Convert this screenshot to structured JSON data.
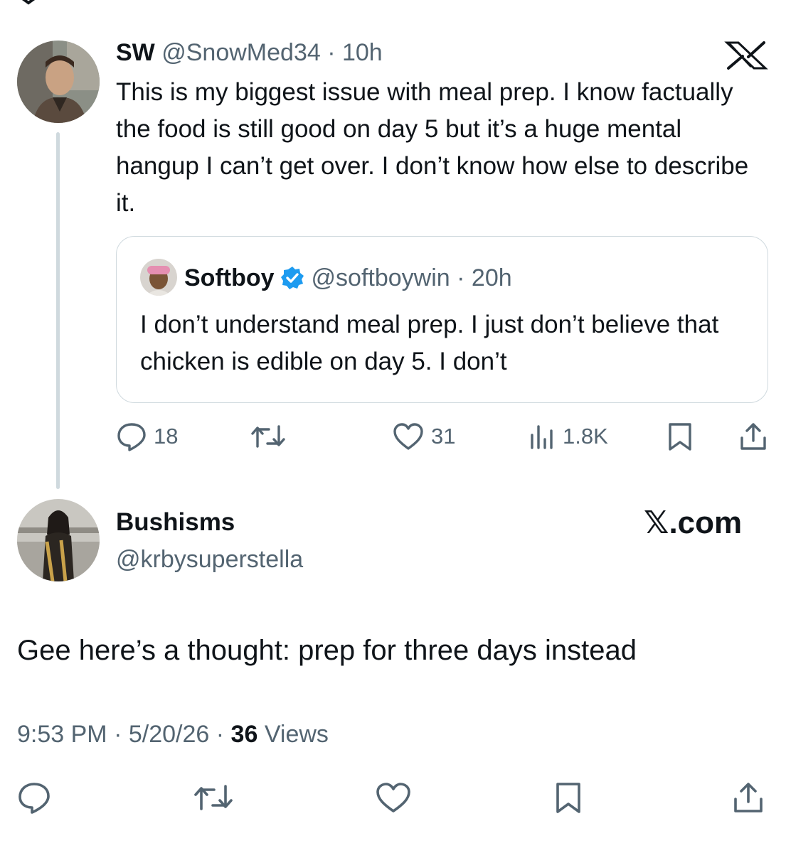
{
  "colors": {
    "text": "#0f1419",
    "secondary": "#536471",
    "border": "#cfd9de",
    "verified": "#1d9bf0"
  },
  "parent_tweet": {
    "name": "SW",
    "handle_time": "@SnowMed34 · 10h",
    "text": "This is my biggest issue with meal prep. I know factually the food is still good on day 5 but it’s a huge mental hangup I can’t get over. I don’t know how else to describe it.",
    "quoted": {
      "name": "Softboy",
      "handle_time": "@softboywin · 20h",
      "text": "I don’t understand meal prep. I just don’t believe that chicken is edible on day 5. I don’t"
    },
    "actions": {
      "replies": "18",
      "likes": "31",
      "views": "1.8K"
    },
    "icons": [
      "reply-icon",
      "retweet-icon",
      "like-icon",
      "views-icon",
      "bookmark-icon",
      "share-icon",
      "x-logo-icon",
      "verified-badge-icon"
    ]
  },
  "reply_tweet": {
    "name": "Bushisms",
    "handle": "@krbysuperstella",
    "watermark": "𝕏.com",
    "text": "Gee here’s a thought: prep for three days instead",
    "time": "9:53 PM",
    "date": "5/20/26",
    "views_count": "36",
    "views_label": "Views"
  }
}
